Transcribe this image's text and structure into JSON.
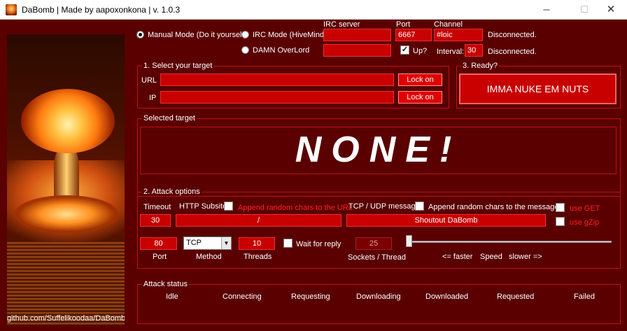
{
  "window": {
    "title": "DaBomb | Made by aapoxonkona | v. 1.0.3",
    "minimize_glyph": "─",
    "maximize_glyph": "☐",
    "close_glyph": "✕"
  },
  "credit": "github.com/Suffelikoodaa/DaBomb",
  "mode": {
    "manual_label": "Manual Mode (Do it yourself)",
    "irc_label": "IRC Mode (HiveMind)",
    "overlord_label": "DAMN OverLord",
    "selected": "manual"
  },
  "irc": {
    "server_label": "IRC server",
    "server_value": "",
    "port_label": "Port",
    "port_value": "6667",
    "channel_label": "Channel",
    "channel_value": "#loic",
    "status1": "Disconnected.",
    "overlord_value": "",
    "up_label": "Up?",
    "up_checked_glyph": "✓",
    "interval_label": "Interval:",
    "interval_value": "30",
    "status2": "Disconnected."
  },
  "select_target": {
    "legend": "1. Select your target",
    "url_label": "URL",
    "url_value": "",
    "url_button": "Lock on",
    "ip_label": "IP",
    "ip_value": "",
    "ip_button": "Lock on"
  },
  "ready": {
    "legend": "3. Ready?",
    "button": "IMMA NUKE EM NUTS"
  },
  "selected_target": {
    "legend": "Selected target",
    "value": "NONE!"
  },
  "attack_options": {
    "legend": "2. Attack options",
    "timeout_label": "Timeout",
    "timeout_value": "30",
    "http_subsite_label": "HTTP Subsite",
    "http_append_label": "Append random chars to the URL",
    "http_subsite_value": "/",
    "message_label": "TCP / UDP message",
    "message_append_label": "Append random chars to the message",
    "message_value": "Shoutout DaBomb",
    "use_get_label": "use GET",
    "use_gzip_label": "use gZip",
    "port_value": "80",
    "port_label": "Port",
    "method_value": "TCP",
    "method_label": "Method",
    "threads_value": "10",
    "threads_label": "Threads",
    "wait_reply_label": "Wait for reply",
    "sockets_value": "25",
    "sockets_label": "Sockets / Thread",
    "faster_label": "<= faster",
    "speed_label": "Speed",
    "slower_label": "slower =>",
    "speed_slider_fraction": 0.0
  },
  "attack_status": {
    "legend": "Attack status",
    "columns": [
      "Idle",
      "Connecting",
      "Requesting",
      "Downloading",
      "Downloaded",
      "Requested",
      "Failed"
    ]
  },
  "colors": {
    "background": "#5a0000",
    "field": "#c80000",
    "border": "#c01010",
    "button": "#e00000"
  }
}
